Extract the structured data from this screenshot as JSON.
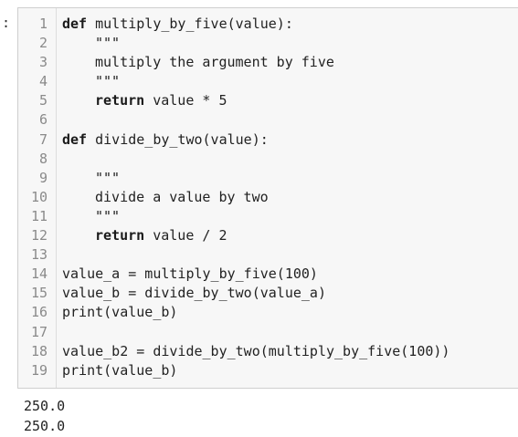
{
  "prompt": ":",
  "line_numbers": [
    "1",
    "2",
    "3",
    "4",
    "5",
    "6",
    "7",
    "8",
    "9",
    "10",
    "11",
    "12",
    "13",
    "14",
    "15",
    "16",
    "17",
    "18",
    "19"
  ],
  "code_lines": [
    {
      "indent": 0,
      "keyword": "def",
      "text": " multiply_by_five(value):"
    },
    {
      "indent": 1,
      "keyword": "",
      "text": "\"\"\""
    },
    {
      "indent": 1,
      "keyword": "",
      "text": "multiply the argument by five"
    },
    {
      "indent": 1,
      "keyword": "",
      "text": "\"\"\""
    },
    {
      "indent": 1,
      "keyword": "return",
      "text": " value * 5"
    },
    {
      "indent": 0,
      "keyword": "",
      "text": ""
    },
    {
      "indent": 0,
      "keyword": "def",
      "text": " divide_by_two(value):"
    },
    {
      "indent": 0,
      "keyword": "",
      "text": ""
    },
    {
      "indent": 1,
      "keyword": "",
      "text": "\"\"\""
    },
    {
      "indent": 1,
      "keyword": "",
      "text": "divide a value by two"
    },
    {
      "indent": 1,
      "keyword": "",
      "text": "\"\"\""
    },
    {
      "indent": 1,
      "keyword": "return",
      "text": " value / 2"
    },
    {
      "indent": 0,
      "keyword": "",
      "text": ""
    },
    {
      "indent": 0,
      "keyword": "",
      "text": "value_a = multiply_by_five(100)"
    },
    {
      "indent": 0,
      "keyword": "",
      "text": "value_b = divide_by_two(value_a)"
    },
    {
      "indent": 0,
      "keyword": "",
      "text": "print(value_b)"
    },
    {
      "indent": 0,
      "keyword": "",
      "text": ""
    },
    {
      "indent": 0,
      "keyword": "",
      "text": "value_b2 = divide_by_two(multiply_by_five(100))"
    },
    {
      "indent": 0,
      "keyword": "",
      "text": "print(value_b)"
    }
  ],
  "output_lines": [
    "250.0",
    "250.0"
  ]
}
